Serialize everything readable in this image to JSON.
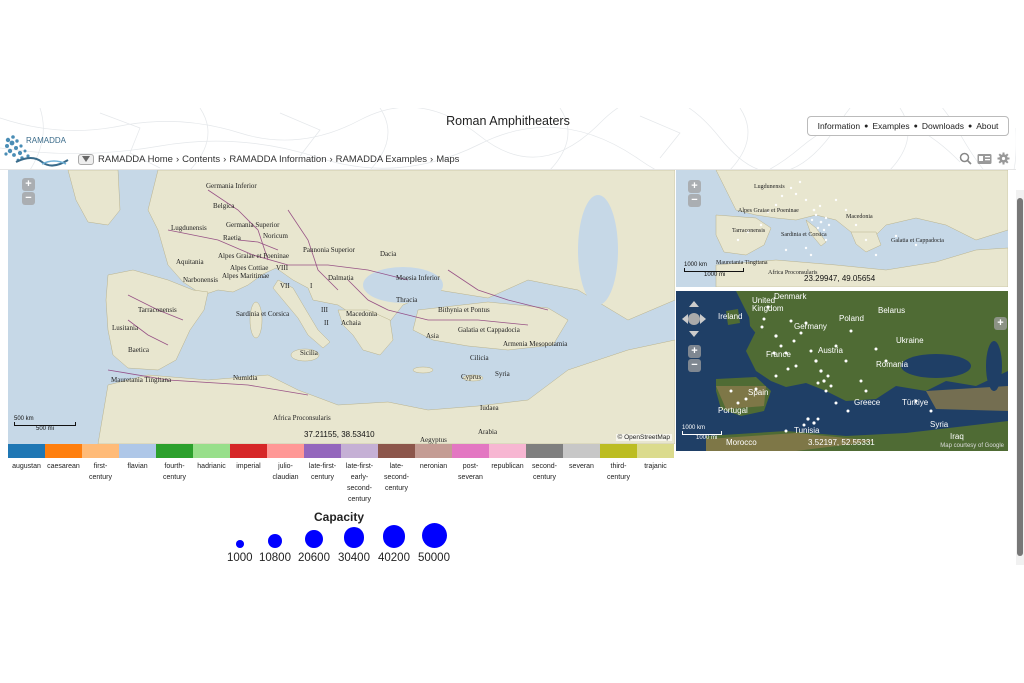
{
  "page": {
    "title": "Roman Amphitheaters",
    "logo_text": "RAMADDA"
  },
  "topnav": [
    "Information",
    "Examples",
    "Downloads",
    "About"
  ],
  "topnav_sep": "●",
  "breadcrumb": [
    "RAMADDA Home",
    "Contents",
    "RAMADDA Information",
    "RAMADDA Examples",
    "Maps"
  ],
  "breadcrumb_sep": "›",
  "header_icons": [
    "search-icon",
    "id-card-icon",
    "gear-icon"
  ],
  "map_main": {
    "coords": "37.21155, 38.53410",
    "scale_km": "500 km",
    "scale_mi": "500 mi",
    "attribution": "© OpenStreetMap",
    "labels": [
      "Germania Inferior",
      "Belgica",
      "Germania Superior",
      "Lugdunensis",
      "Raetia",
      "Noricum",
      "Aquitania",
      "Alpes Graiae et Poeninae",
      "Alpes Cottiae",
      "Alpes Maritimae",
      "Pannonia Superior",
      "Dacia",
      "VIII",
      "VII",
      "I",
      "Dalmatia",
      "Moesia Inferior",
      "Narbonensis",
      "Thracia",
      "Tarraconensis",
      "Sardinia et Corsica",
      "III",
      "II",
      "Macedonia",
      "Bithynia et Pontus",
      "Lusitania",
      "Achaia",
      "Galatia et Cappadocia",
      "Baetica",
      "Asia",
      "Armenia Mesopotamia",
      "Sicilia",
      "Cilicia",
      "Mauretania Tingitana",
      "Numidia",
      "Cyprus",
      "Syria",
      "Africa Proconsularis",
      "Iudaea",
      "Arabia",
      "Aegyptus"
    ]
  },
  "map_topright": {
    "coords": "23.29947, 49.05654",
    "scale_km": "1000 km",
    "scale_mi": "1000 mi",
    "labels": [
      "Lugdunensis",
      "Alpes Graiae et Poeninae",
      "Tarraconensis",
      "Sardinia et Corsica",
      "Mauretania Tingitana",
      "Galatia et Cappadocia",
      "Africa Proconsularis",
      "Macedonia"
    ]
  },
  "map_sat": {
    "coords": "3.52197, 52.55331",
    "scale_km": "1000 km",
    "scale_mi": "1000 mi",
    "attribution": "Map courtesy of Google",
    "labels": [
      "Denmark",
      "United Kingdom",
      "Ireland",
      "Poland",
      "Belarus",
      "Germany",
      "Ukraine",
      "Austria",
      "France",
      "Romania",
      "Spain",
      "Greece",
      "Portugal",
      "Türkiye",
      "Tunisia",
      "Syria",
      "Iraq",
      "Morocco"
    ]
  },
  "legend": [
    {
      "label": "augustan",
      "color": "#1f77b4"
    },
    {
      "label": "caesarean",
      "color": "#ff7f0e"
    },
    {
      "label": "first-century",
      "color": "#ffbb78"
    },
    {
      "label": "flavian",
      "color": "#aec7e8"
    },
    {
      "label": "fourth-century",
      "color": "#2ca02c"
    },
    {
      "label": "hadrianic",
      "color": "#98df8a"
    },
    {
      "label": "imperial",
      "color": "#d62728"
    },
    {
      "label": "julio-claudian",
      "color": "#ff9896"
    },
    {
      "label": "late-first-century",
      "color": "#9467bd"
    },
    {
      "label": "late-first-early-second-century",
      "color": "#c5b0d5"
    },
    {
      "label": "late-second-century",
      "color": "#8c564b"
    },
    {
      "label": "neronian",
      "color": "#c49c94"
    },
    {
      "label": "post-severan",
      "color": "#e377c2"
    },
    {
      "label": "republican",
      "color": "#f7b6d2"
    },
    {
      "label": "second-century",
      "color": "#7f7f7f"
    },
    {
      "label": "severan",
      "color": "#c7c7c7"
    },
    {
      "label": "third-century",
      "color": "#bcbd22"
    },
    {
      "label": "trajanic",
      "color": "#dbdb8d"
    }
  ],
  "legend_display": [
    "augustan",
    "caesarean",
    "first-\ncentury",
    "flavian",
    "fourth-\ncentury",
    "hadrianic",
    "imperial",
    "julio-\nclaudian",
    "late-first-\ncentury",
    "late-first-\nearly-\nsecond-\ncentury",
    "late-\nsecond-\ncentury",
    "neronian",
    "post-\nseveran",
    "republican",
    "second-\ncentury",
    "severan",
    "third-\ncentury",
    "trajanic"
  ],
  "capacity": {
    "title": "Capacity",
    "values": [
      1000,
      10800,
      20600,
      30400,
      40200,
      50000
    ],
    "color": "#0000ff"
  }
}
